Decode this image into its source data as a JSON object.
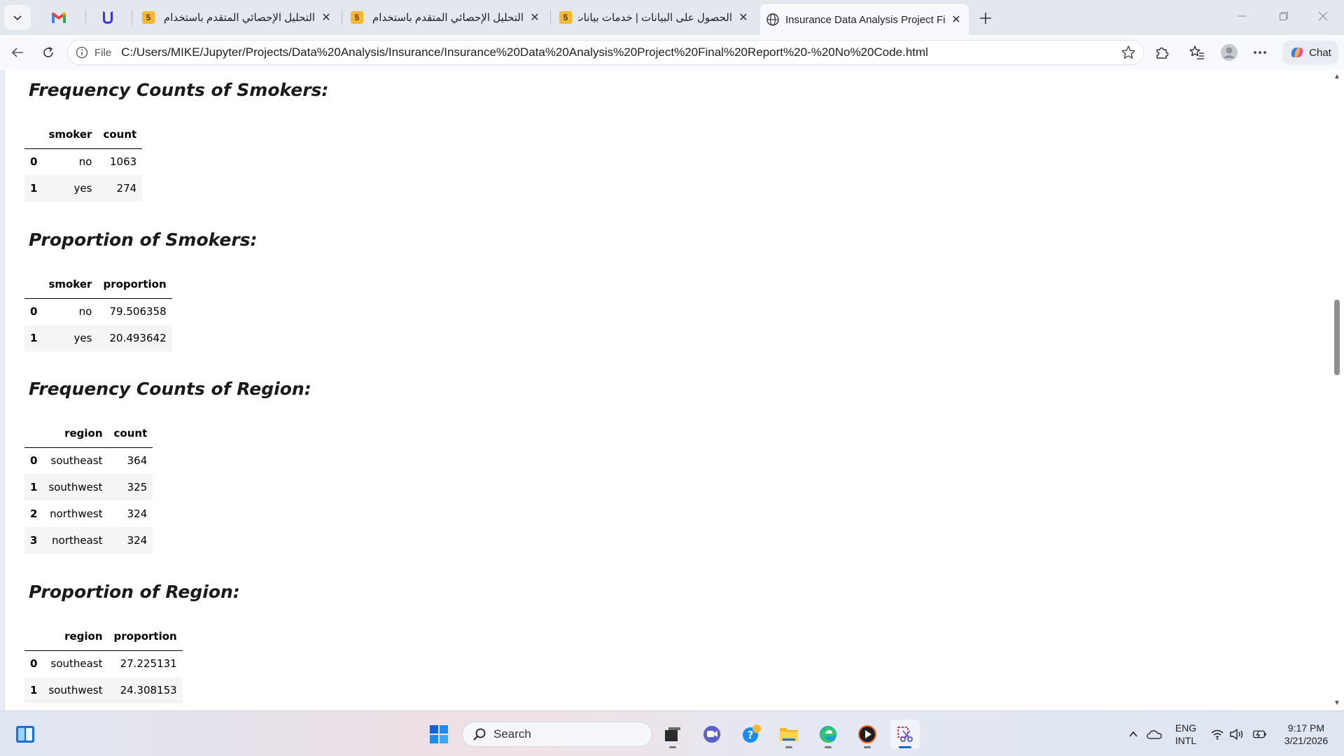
{
  "browser": {
    "tabs": [
      {
        "title": "التحليل الإحصائي المتقدم باستخدام n",
        "favicon": "badge-5-icon",
        "badge": "5",
        "active": false
      },
      {
        "title": "التحليل الإحصائي المتقدم باستخدام R",
        "favicon": "badge-5-icon",
        "badge": "5",
        "active": false
      },
      {
        "title": "الحصول على البيانات | خدمات بيانات",
        "favicon": "badge-5-icon",
        "badge": "5",
        "active": false
      },
      {
        "title": "Insurance Data Analysis Project Fin",
        "favicon": "globe-icon",
        "active": true
      }
    ],
    "address": {
      "scheme_label": "File",
      "url": "C:/Users/MIKE/Jupyter/Projects/Data%20Analysis/Insurance/Insurance%20Data%20Analysis%20Project%20Final%20Report%20-%20No%20Code.html"
    },
    "chat_label": "Chat"
  },
  "report": {
    "sections": [
      {
        "title": "Frequency Counts of Smokers:",
        "columns": [
          "smoker",
          "count"
        ],
        "rows": [
          [
            "0",
            "no",
            "1063"
          ],
          [
            "1",
            "yes",
            "274"
          ]
        ]
      },
      {
        "title": "Proportion of Smokers:",
        "columns": [
          "smoker",
          "proportion"
        ],
        "rows": [
          [
            "0",
            "no",
            "79.506358"
          ],
          [
            "1",
            "yes",
            "20.493642"
          ]
        ]
      },
      {
        "title": "Frequency Counts of Region:",
        "columns": [
          "region",
          "count"
        ],
        "rows": [
          [
            "0",
            "southeast",
            "364"
          ],
          [
            "1",
            "southwest",
            "325"
          ],
          [
            "2",
            "northwest",
            "324"
          ],
          [
            "3",
            "northeast",
            "324"
          ]
        ]
      },
      {
        "title": "Proportion of Region:",
        "columns": [
          "region",
          "proportion"
        ],
        "rows": [
          [
            "0",
            "southeast",
            "27.225131"
          ],
          [
            "1",
            "southwest",
            "24.308153"
          ]
        ]
      }
    ]
  },
  "taskbar": {
    "search_placeholder": "Search",
    "language": "ENG",
    "layout": "INTL",
    "time": "9:17 PM",
    "date": "3/21/2026"
  },
  "colors": {
    "accent": "#0a64d8",
    "badge": "#f5b82e"
  }
}
